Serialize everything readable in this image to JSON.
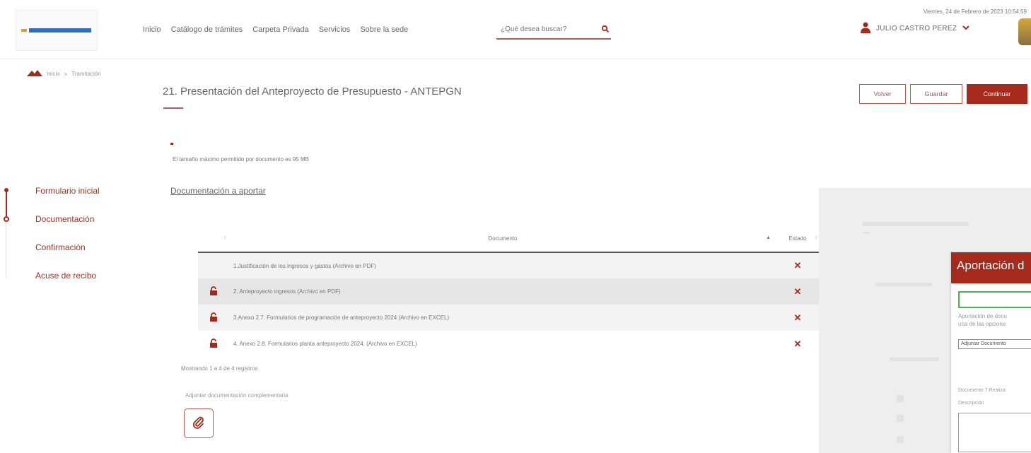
{
  "header": {
    "nav": [
      "Inicio",
      "Catálogo de trámites",
      "Carpeta Privada",
      "Servicios",
      "Sobre la sede"
    ],
    "search_placeholder": "¿Qué desea buscar?",
    "datetime": "Viernes, 24 de Febrero de 2023 10:54:59",
    "user_name": "JULIO CASTRO PEREZ"
  },
  "breadcrumb": [
    "Inicio",
    "Tramitación"
  ],
  "page": {
    "title": "21. Presentación del Anteproyecto de Presupuesto - ANTEPGN",
    "info": "El tamaño máximo permitido por documento es 95 MB",
    "section_link": "Documentación a aportar",
    "buttons": {
      "back": "Volver",
      "save": "Guardar",
      "continue": "Continuar"
    }
  },
  "stepper": [
    "Formulario inicial",
    "Documentación",
    "Confirmación",
    "Acuse de recibo"
  ],
  "table": {
    "columns": [
      "Documento",
      "Estado"
    ],
    "rows": [
      {
        "doc": "1.Justificación de los ingresos y gastos (Archivo en PDF)",
        "state": "✕",
        "locked": false
      },
      {
        "doc": "2. Anteproyecto ingresos (Archivo en PDF)",
        "state": "✕",
        "locked": true
      },
      {
        "doc": "3.Anexo 2.7. Formularios de programación de anteproyecto 2024 (Archivo en EXCEL)",
        "state": "✕",
        "locked": true
      },
      {
        "doc": "4. Anexo 2.8. Formularios planta anteproyecto 2024. (Archivo en EXCEL)",
        "state": "✕",
        "locked": true
      }
    ],
    "footer": "Mostrando 1 a 4 de 4 registros"
  },
  "attach": {
    "label": "Adjuntar documentación complementaria"
  },
  "modal": {
    "title": "Aportación d",
    "text_line1": "Aportación de docu",
    "text_line2": "una de las opcione",
    "select_value": "Adjuntar Documento",
    "doc_label": "Documento 7 Realiza",
    "description_label": "Descripción"
  },
  "colors": {
    "brand": "#a52a1c",
    "accent": "#b85a52",
    "success": "#4caf50"
  }
}
